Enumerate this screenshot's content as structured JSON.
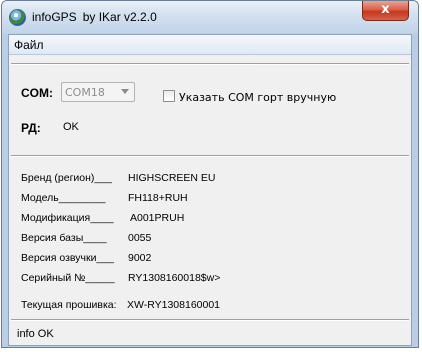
{
  "window": {
    "title": "infoGPS",
    "author": "by IKar v2.2.0",
    "close_glyph": "x"
  },
  "menu": {
    "file_label": "Файл"
  },
  "connection": {
    "com_label": "COM:",
    "com_value": "COM18",
    "manual_com_label": "Указать COM  горт вручную",
    "manual_com_checked": false,
    "rd_label": "РД:",
    "rd_value": "OK"
  },
  "device_info": [
    {
      "label": "Бренд (регион)___",
      "value": "HIGHSCREEN  EU"
    },
    {
      "label": "Модель________",
      "value": "FH118+RUH"
    },
    {
      "label": "Модификация____",
      "value": "A001PRUH"
    },
    {
      "label": "Версия базы____",
      "value": "0055"
    },
    {
      "label": "Версия озвучки___",
      "value": "9002"
    },
    {
      "label": "Серийный №_____",
      "value": "RY1308160018$w>"
    }
  ],
  "firmware": {
    "label": "Текущая прошивка:",
    "value": "XW-RY1308160001"
  },
  "status": {
    "text": "info OK"
  }
}
